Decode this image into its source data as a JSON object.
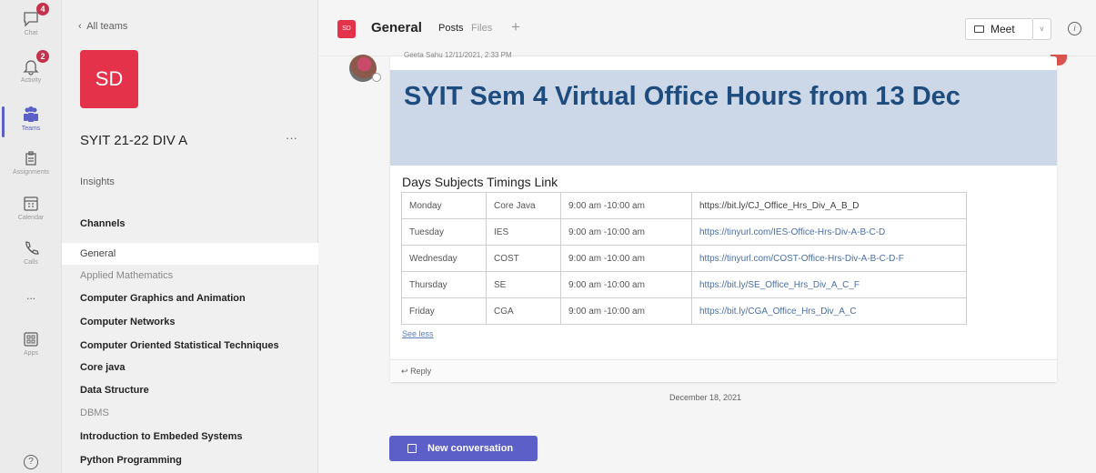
{
  "rail": {
    "items": [
      {
        "label": "Chat",
        "badge": "4"
      },
      {
        "label": "Activity",
        "badge": "2"
      },
      {
        "label": "Teams",
        "badge": ""
      },
      {
        "label": "Assignments",
        "badge": ""
      },
      {
        "label": "Calendar",
        "badge": ""
      },
      {
        "label": "Calls",
        "badge": ""
      },
      {
        "label": "...",
        "badge": ""
      },
      {
        "label": "Apps",
        "badge": ""
      }
    ],
    "help": "?"
  },
  "sidebar": {
    "back_label": "All teams",
    "team_initials": "SD",
    "team_name": "SYIT 21-22 DIV A",
    "more": "···",
    "insights": "Insights",
    "channels_heading": "Channels",
    "channels": [
      "General",
      "Applied Mathematics",
      "Computer Graphics and Animation",
      "Computer Networks",
      "Computer Oriented Statistical Techniques",
      "Core java",
      "Data Structure",
      "DBMS",
      "Introduction to Embeded Systems",
      "Python Programming"
    ]
  },
  "header": {
    "badge": "SD",
    "channel_title": "General",
    "tabs": [
      "Posts",
      "Files",
      "+"
    ],
    "meet_label": "Meet",
    "meet_dropdown": "v",
    "info": "i"
  },
  "post": {
    "author_line": "Geeta Sahu 12/11/2021, 2:33 PM",
    "headline": "SYIT Sem 4 Virtual Office Hours from 13 Dec",
    "table_caption": "Days Subjects Timings Link",
    "rows": [
      [
        "Monday",
        "Core Java",
        "9:00 am -10:00 am",
        "https://bit.ly/CJ_Office_Hrs_Div_A_B_D"
      ],
      [
        "Tuesday",
        "IES",
        "9:00 am -10:00 am",
        "https://tinyurl.com/IES-Office-Hrs-Div-A-B-C-D"
      ],
      [
        "Wednesday",
        "COST",
        "9:00 am -10:00 am",
        "https://tinyurl.com/COST-Office-Hrs-Div-A-B-C-D-F"
      ],
      [
        "Thursday",
        "SE",
        "9:00 am -10:00 am",
        "https://bit.ly/SE_Office_Hrs_Div_A_C_F"
      ],
      [
        "Friday",
        "CGA",
        "9:00 am -10:00 am",
        "https://bit.ly/CGA_Office_Hrs_Div_A_C"
      ]
    ],
    "see_less": "See less",
    "reply": "Reply"
  },
  "date_separator": "December 18, 2021",
  "new_conversation": "New conversation"
}
